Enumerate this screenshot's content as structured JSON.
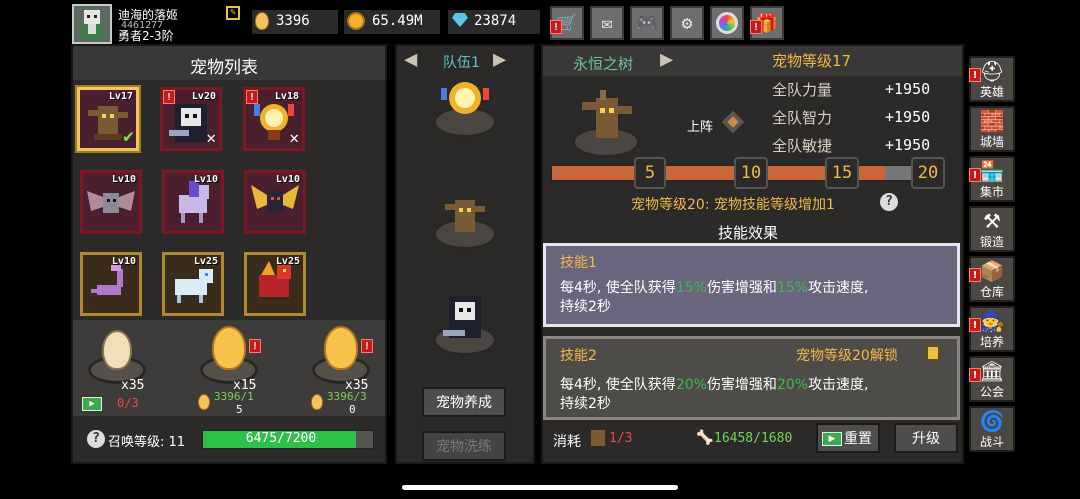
{
  "player": {
    "name": "迪海的落姬",
    "id": "4461277",
    "rank": "勇者2-3阶"
  },
  "currencies": {
    "eggs": "3396",
    "gold": "65.49M",
    "gems": "23874"
  },
  "top_icons": [
    "shop-cart-icon",
    "mail-icon",
    "gamepad-icon",
    "settings-gear-icon",
    "color-wheel-icon",
    "gift-icon"
  ],
  "pet_list": {
    "title": "宠物列表",
    "pets": [
      {
        "level": "Lv17",
        "selected": true,
        "checked": true,
        "frame": "red"
      },
      {
        "level": "Lv20",
        "badge": "!",
        "crossed": true,
        "frame": "red"
      },
      {
        "level": "Lv18",
        "badge": "!",
        "crossed": true,
        "frame": "red"
      },
      {
        "level": "Lv10",
        "frame": "red"
      },
      {
        "level": "Lv10",
        "frame": "red"
      },
      {
        "level": "Lv10",
        "frame": "red"
      },
      {
        "level": "Lv10",
        "frame": "gold"
      },
      {
        "level": "Lv25",
        "frame": "gold"
      },
      {
        "level": "Lv25",
        "frame": "gold"
      }
    ],
    "eggs": [
      {
        "count": "x35",
        "cost": "0/3"
      },
      {
        "count": "x15",
        "cost": "3396/1",
        "cost2": "5"
      },
      {
        "count": "x35",
        "cost": "3396/3",
        "cost2": "0"
      }
    ],
    "summon_label": "召唤等级: 11",
    "summon_progress": "6475/7200",
    "summon_fraction": 0.899
  },
  "team": {
    "title": "队伍1",
    "nurture_button": "宠物养成",
    "wash_button": "宠物洗练"
  },
  "pet_detail": {
    "name": "永恒之树",
    "level_label": "宠物等级17",
    "deploy_label": "上阵",
    "stats": [
      {
        "label": "全队力量",
        "value": "+1950"
      },
      {
        "label": "全队智力",
        "value": "+1950"
      },
      {
        "label": "全队敏捷",
        "value": "+1950"
      }
    ],
    "milestones": [
      "5",
      "10",
      "15",
      "20"
    ],
    "level_fraction": 0.85,
    "milestone_note": "宠物等级20: 宠物技能等级增加1"
  },
  "skills": {
    "header": "技能效果",
    "list": [
      {
        "name": "技能1",
        "pre": "每4秒, 使全队获得",
        "p1": "15%",
        "mid": "伤害增强和",
        "p2": "15%",
        "post": "攻击速度,",
        "line2": "持续2秒"
      },
      {
        "name": "技能2",
        "lock_note": "宠物等级20解锁",
        "pre": "每4秒, 使全队获得",
        "p1": "20%",
        "mid": "伤害增强和",
        "p2": "20%",
        "post": "攻击速度,",
        "line2": "持续2秒"
      }
    ]
  },
  "footer": {
    "consume_label": "消耗",
    "consume_value": "1/3",
    "bone_value": "16458/1680",
    "reset_button": "重置",
    "upgrade_button": "升级"
  },
  "side_nav": [
    {
      "label": "英雄",
      "icon": "helmet-icon"
    },
    {
      "label": "城墙",
      "icon": "wall-icon"
    },
    {
      "label": "集市",
      "icon": "market-icon"
    },
    {
      "label": "锻造",
      "icon": "anvil-icon"
    },
    {
      "label": "仓库",
      "icon": "warehouse-icon"
    },
    {
      "label": "培养",
      "icon": "wizard-icon"
    },
    {
      "label": "公会",
      "icon": "guild-icon"
    },
    {
      "label": "战斗",
      "icon": "battle-portal-icon"
    }
  ],
  "colors": {
    "accent_gold": "#f0b84a",
    "progress_green": "#2fc04a",
    "skill_green": "#3fb84a",
    "level_bar": "#c9663a"
  }
}
